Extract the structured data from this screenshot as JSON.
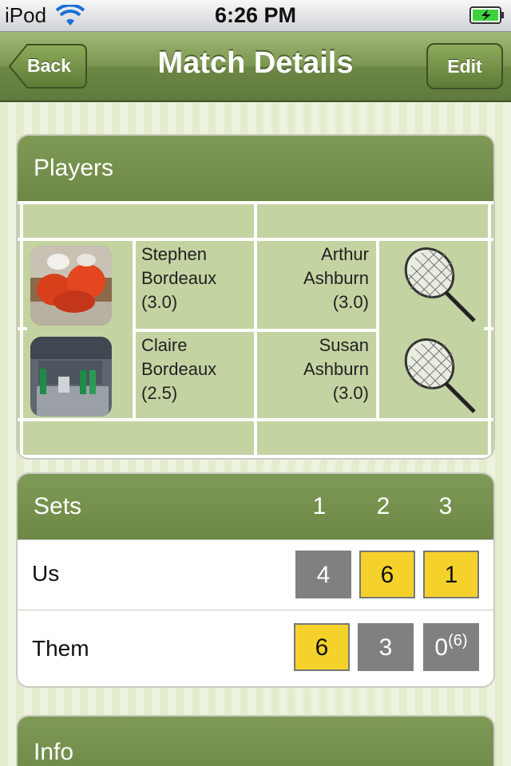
{
  "status_bar": {
    "carrier": "iPod",
    "time": "6:26 PM"
  },
  "nav": {
    "title": "Match Details",
    "back_label": "Back",
    "edit_label": "Edit"
  },
  "players": {
    "header": "Players",
    "team_us": [
      {
        "first": "Stephen",
        "last": "Bordeaux",
        "rating": "(3.0)"
      },
      {
        "first": "Claire",
        "last": "Bordeaux",
        "rating": "(2.5)"
      }
    ],
    "team_them": [
      {
        "first": "Arthur",
        "last": "Ashburn",
        "rating": "(3.0)"
      },
      {
        "first": "Susan",
        "last": "Ashburn",
        "rating": "(3.0)"
      }
    ]
  },
  "sets": {
    "header": "Sets",
    "columns": [
      "1",
      "2",
      "3"
    ],
    "rows": [
      {
        "team": "Us",
        "scores": [
          "4",
          "6",
          "1"
        ]
      },
      {
        "team": "Them",
        "scores": [
          "6",
          "3",
          "0"
        ],
        "tiebreak": "(6)"
      }
    ]
  },
  "info": {
    "header": "Info"
  },
  "colors": {
    "win": "#f5d22b",
    "lose": "#808080",
    "header_green": "#7b9650",
    "court_green": "#c4d3a2"
  }
}
